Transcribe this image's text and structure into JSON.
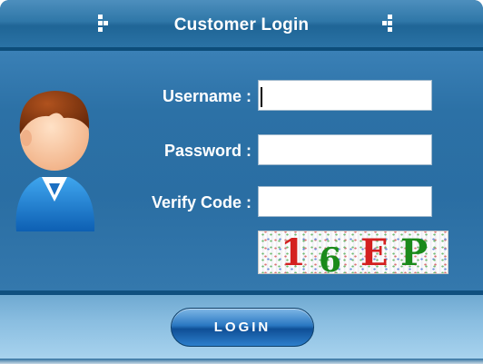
{
  "header": {
    "title": "Customer Login"
  },
  "form": {
    "username_label": "Username :",
    "username_value": "",
    "password_label": "Password :",
    "password_value": "",
    "verify_label": "Verify Code :",
    "verify_value": "",
    "captcha": {
      "chars": [
        "1",
        "6",
        "E",
        "P"
      ],
      "colors": [
        "#d42020",
        "#1a8a1a",
        "#d42020",
        "#1a8a1a"
      ]
    }
  },
  "actions": {
    "login_label": "LOGIN"
  },
  "icons": {
    "avatar": "user-avatar-icon",
    "header_left": "grid-dots-icon",
    "header_right": "grid-dots-icon"
  },
  "colors": {
    "header": "#2f77a8",
    "body": "#2c71a6",
    "footer": "#89bde0",
    "button": "#2a78c2"
  }
}
